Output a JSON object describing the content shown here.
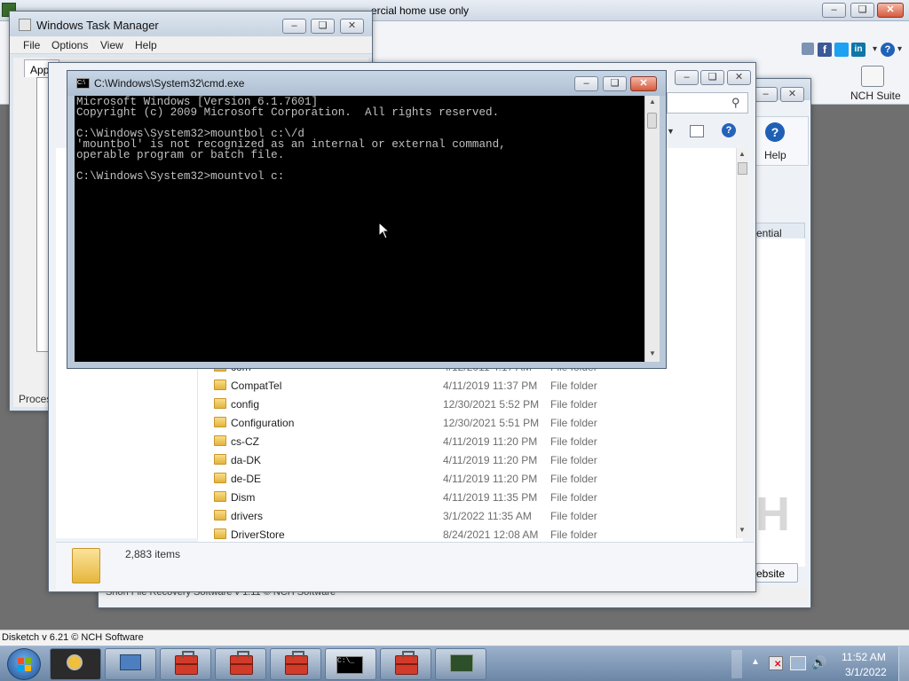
{
  "disketch_window": {
    "title": "Disketch by NCH Software (Unlicensed) Non-commercial home use only",
    "title_visible_part": "ercial home use only",
    "nch_suite_label": "NCH Suite",
    "help_label": "Help",
    "website_label": "ebsite",
    "potential_label": "ential",
    "footer_text": "Shoh File Recovery Software v 1.11 © NCH Software",
    "status_text": "Disketch v 6.21 © NCH Software"
  },
  "task_manager": {
    "title": "Windows Task Manager",
    "menu": [
      "File",
      "Options",
      "View",
      "Help"
    ],
    "tab_partial": "Appl",
    "status_partial": "Proces"
  },
  "cmd": {
    "title": "C:\\Windows\\System32\\cmd.exe",
    "lines": [
      "Microsoft Windows [Version 6.1.7601]",
      "Copyright (c) 2009 Microsoft Corporation.  All rights reserved.",
      "",
      "C:\\Windows\\System32>mountbol c:\\/d",
      "'mountbol' is not recognized as an internal or external command,",
      "operable program or batch file.",
      "",
      "C:\\Windows\\System32>mountvol c:"
    ]
  },
  "explorer": {
    "item_count": "2,883 items",
    "header_partial": "e",
    "files": [
      {
        "name": "com",
        "date": "4/12/2011 4:17 AM",
        "type": "File folder"
      },
      {
        "name": "CompatTel",
        "date": "4/11/2019 11:37 PM",
        "type": "File folder"
      },
      {
        "name": "config",
        "date": "12/30/2021 5:52 PM",
        "type": "File folder"
      },
      {
        "name": "Configuration",
        "date": "12/30/2021 5:51 PM",
        "type": "File folder"
      },
      {
        "name": "cs-CZ",
        "date": "4/11/2019 11:20 PM",
        "type": "File folder"
      },
      {
        "name": "da-DK",
        "date": "4/11/2019 11:20 PM",
        "type": "File folder"
      },
      {
        "name": "de-DE",
        "date": "4/11/2019 11:20 PM",
        "type": "File folder"
      },
      {
        "name": "Dism",
        "date": "4/11/2019 11:35 PM",
        "type": "File folder"
      },
      {
        "name": "drivers",
        "date": "3/1/2022 11:35 AM",
        "type": "File folder"
      },
      {
        "name": "DriverStore",
        "date": "8/24/2021 12:08 AM",
        "type": "File folder"
      }
    ]
  },
  "taskbar": {
    "time": "11:52 AM",
    "date": "3/1/2022"
  },
  "colors": {
    "desktop": "#6f6f6f",
    "console_bg": "#000000",
    "console_fg": "#c0c0c0",
    "taskbar": "#7f98b7",
    "close_red": "#d45a3c"
  }
}
